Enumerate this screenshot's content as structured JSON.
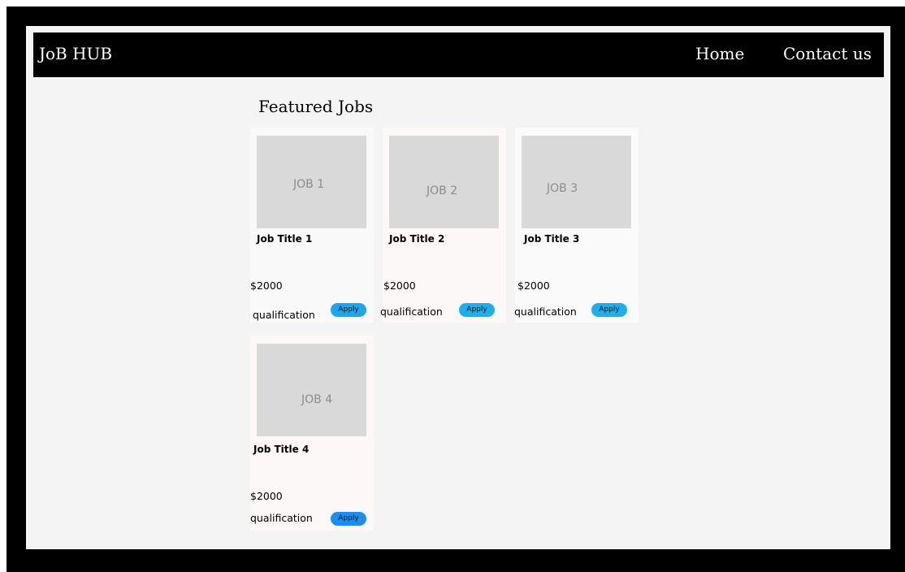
{
  "header": {
    "brand": "JoB HUB",
    "nav": [
      {
        "label": "Home"
      },
      {
        "label": "Contact us"
      }
    ]
  },
  "main": {
    "section_title": "Featured Jobs",
    "jobs": [
      {
        "thumbnail_label": "JOB 1",
        "title": "Job Title 1",
        "salary": "$2000",
        "qualification": "qualification",
        "apply_label": "Apply",
        "apply_color": "#1aa7ee"
      },
      {
        "thumbnail_label": "JOB 2",
        "title": "Job Title 2",
        "salary": "$2000",
        "qualification": "qualification",
        "apply_label": "Apply",
        "apply_color": "#1ab0f0"
      },
      {
        "thumbnail_label": "JOB 3",
        "title": "Job Title 3",
        "salary": "$2000",
        "qualification": "qualification",
        "apply_label": "Apply",
        "apply_color": "#1ab0f0"
      },
      {
        "thumbnail_label": "JOB 4",
        "title": "Job Title 4",
        "salary": "$2000",
        "qualification": "qualification",
        "apply_label": "Apply",
        "apply_color": "#1a8ff0"
      }
    ]
  },
  "colors": {
    "frame": "#000000",
    "navbar": "#000000",
    "canvas": "#f4f4f4",
    "thumbnail": "#d9d9d9"
  }
}
